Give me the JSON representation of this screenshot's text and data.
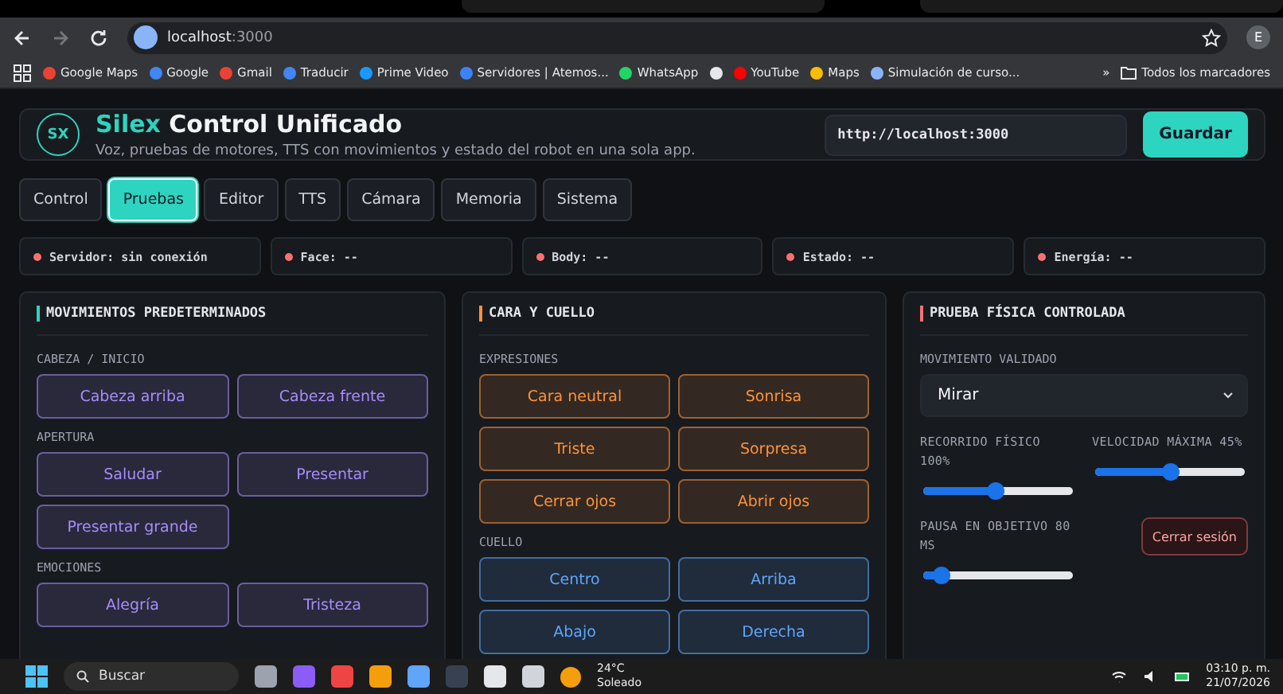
{
  "browser": {
    "host": "localhost",
    "port": ":3000",
    "profile": "E",
    "more": "»",
    "all_bookmarks": "Todos los marcadores",
    "bookmarks": [
      {
        "label": "Google Maps",
        "color": "#ea4335"
      },
      {
        "label": "Google",
        "color": "#4285f4"
      },
      {
        "label": "Gmail",
        "color": "#ea4335"
      },
      {
        "label": "Traducir",
        "color": "#4285f4"
      },
      {
        "label": "Prime Video",
        "color": "#1a98ff"
      },
      {
        "label": "Servidores | Atemos...",
        "color": "#3b82f6"
      },
      {
        "label": "WhatsApp",
        "color": "#25d366"
      },
      {
        "kind": "icon",
        "color": "#e5e7eb"
      },
      {
        "label": "YouTube",
        "color": "#ff0000"
      },
      {
        "label": "Maps",
        "color": "#fbbc04"
      },
      {
        "label": "Simulación de curso...",
        "color": "#8ab4f8"
      }
    ]
  },
  "header": {
    "logo": "SX",
    "title_accent": "Silex",
    "title": "Control Unificado",
    "subtitle": "Voz, pruebas de motores, TTS con movimientos y estado del robot en una sola app.",
    "server_url": "http://localhost:3000",
    "save": "Guardar"
  },
  "tabs": [
    {
      "label": "Control",
      "selected": false
    },
    {
      "label": "Pruebas",
      "selected": true
    },
    {
      "label": "Editor",
      "selected": false
    },
    {
      "label": "TTS",
      "selected": false
    },
    {
      "label": "Cámara",
      "selected": false
    },
    {
      "label": "Memoria",
      "selected": false
    },
    {
      "label": "Sistema",
      "selected": false
    }
  ],
  "status": [
    {
      "label": "Servidor: sin conexión",
      "online": false
    },
    {
      "label": "Face: --",
      "online": false
    },
    {
      "label": "Body: --",
      "online": false
    },
    {
      "label": "Estado: --",
      "online": false
    },
    {
      "label": "Energía: --",
      "online": false
    }
  ],
  "panels": [
    {
      "kind": "buttons",
      "title": "MOVIMIENTOS PREDETERMINADOS",
      "color": "#2dd4bf",
      "groups": [
        {
          "label": "CABEZA / INICIO",
          "color": "#a78bfa",
          "buttons": [
            "Cabeza arriba",
            "Cabeza frente"
          ]
        },
        {
          "label": "APERTURA",
          "color": "#a78bfa",
          "buttons": [
            "Saludar",
            "Presentar",
            "Presentar grande"
          ]
        },
        {
          "label": "EMOCIONES",
          "color": "#a78bfa",
          "buttons": [
            "Alegría",
            "Tristeza"
          ]
        }
      ]
    },
    {
      "kind": "buttons",
      "title": "CARA Y CUELLO",
      "color": "#fb923c",
      "groups": [
        {
          "label": "EXPRESIONES",
          "color": "#fb923c",
          "buttons": [
            "Cara neutral",
            "Sonrisa",
            "Triste",
            "Sorpresa",
            "Cerrar ojos",
            "Abrir ojos"
          ]
        },
        {
          "label": "CUELLO",
          "color": "#60a5fa",
          "buttons": [
            "Centro",
            "Arriba",
            "Abajo",
            "Derecha"
          ]
        }
      ]
    },
    {
      "kind": "controls",
      "title": "PRUEBA FÍSICA CONTROLADA",
      "color": "#f87171",
      "select_label": "MOVIMIENTO VALIDADO",
      "select_value": "Mirar",
      "sliders": [
        {
          "label": "RECORRIDO FÍSICO 100%",
          "level": 0.48
        },
        {
          "label": "VELOCIDAD MÁXIMA 45%",
          "level": 0.5
        },
        {
          "label": "PAUSA EN OBJETIVO 80 MS",
          "level": 0.12
        }
      ],
      "logout": "Cerrar sesión"
    }
  ],
  "taskbar": {
    "search": "Buscar",
    "temperature": "24°C",
    "weather": "Soleado",
    "time": "03:10 p. m.",
    "date": "21/07/2026"
  }
}
